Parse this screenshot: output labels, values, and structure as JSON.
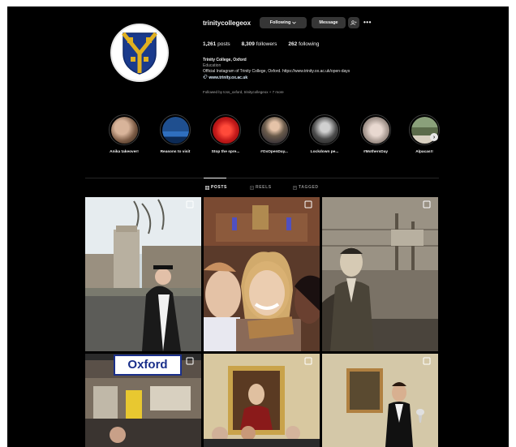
{
  "profile": {
    "username": "trinitycollegeox",
    "following_label": "Following",
    "message_label": "Message",
    "stats": {
      "posts": "1,261",
      "posts_label": "posts",
      "followers": "8,309",
      "followers_label": "followers",
      "following": "262",
      "following_label": "following"
    },
    "bio": {
      "name": "Trinity College, Oxford",
      "category": "Education",
      "description": "Official Instagram of Trinity College, Oxford. https://www.trinity.ox.ac.uk/open-days",
      "link": "www.trinity.ox.ac.uk"
    },
    "followed_by": "Followed by tcss_oxford, trinitycollegeox + 7 more"
  },
  "highlights": [
    {
      "label": "Anika takeover!",
      "color": "#8a6a55"
    },
    {
      "label": "Reasons to visit",
      "color": "#1f4f8f"
    },
    {
      "label": "Stop the spre...",
      "color": "#c41a1a"
    },
    {
      "label": "#OxOpenDay...",
      "color": "#6b5c4c"
    },
    {
      "label": "Lockdown pe...",
      "color": "#4a4a4a"
    },
    {
      "label": "#MothersDay",
      "color": "#a89a92"
    },
    {
      "label": "Alpacas!!",
      "color": "#5b6b4a"
    }
  ],
  "tabs": {
    "posts": "POSTS",
    "reels": "REELS",
    "tagged": "TAGGED"
  },
  "posts": {
    "sign_text": "Oxford"
  },
  "colors": {
    "background": "#000000",
    "button": "#363636",
    "text": "#f5f5f5",
    "muted": "#a8a8a8",
    "crest_blue": "#1a3a8c",
    "crest_gold": "#e0b020"
  }
}
